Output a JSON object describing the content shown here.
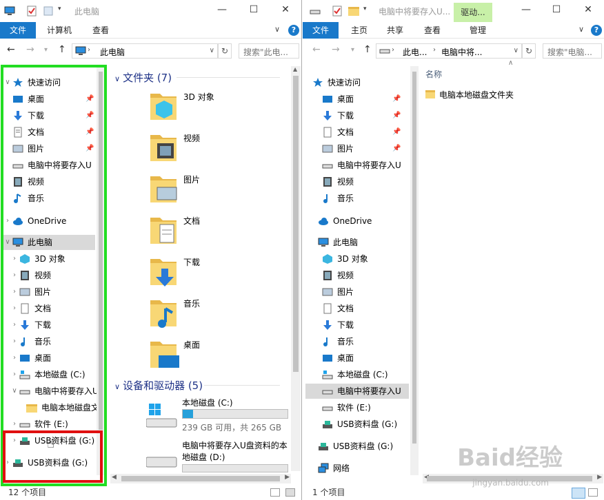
{
  "left": {
    "title": "此电脑",
    "ribbon": {
      "file": "文件",
      "tab1": "计算机",
      "tab2": "查看"
    },
    "address": {
      "path": "此电脑",
      "search_placeholder": "搜索\"此电..."
    },
    "nav": {
      "quick_access": "快速访问",
      "desktop": "桌面",
      "downloads": "下载",
      "documents": "文档",
      "pictures": "图片",
      "drive_d_short": "电脑中将要存入U",
      "videos": "视频",
      "music": "音乐",
      "onedrive": "OneDrive",
      "this_pc": "此电脑",
      "objects3d": "3D 对象",
      "videos2": "视频",
      "pictures2": "图片",
      "documents2": "文档",
      "downloads2": "下载",
      "music2": "音乐",
      "desktop2": "桌面",
      "drive_c": "本地磁盘 (C:)",
      "drive_d": "电脑中将要存入U",
      "subfolder": "电脑本地磁盘文",
      "drive_e": "软件 (E:)",
      "usb_g": "USB资料盘 (G:)",
      "usb_g2": "USB资料盘 (G:)"
    },
    "content": {
      "folders_header": "文件夹 (7)",
      "folders": [
        "3D 对象",
        "视频",
        "图片",
        "文档",
        "下载",
        "音乐",
        "桌面"
      ],
      "devices_header": "设备和驱动器 (5)",
      "drive_c_name": "本地磁盘 (C:)",
      "drive_c_space": "239 GB 可用，共 265 GB",
      "drive_c_used_fraction": 0.1,
      "drive_d_name_line1": "电脑中将要存入U盘资料的本",
      "drive_d_name_line2": "地磁盘 (D:)"
    },
    "status": "12 个项目"
  },
  "right": {
    "title": "电脑中将要存入U...",
    "context_tab": "驱动...",
    "ribbon": {
      "file": "文件",
      "tab1": "主页",
      "tab2": "共享",
      "tab3": "查看",
      "tab4": "管理"
    },
    "address": {
      "path1": "此电...",
      "path2": "电脑中将...",
      "search_placeholder": "搜索\"电脑..."
    },
    "nav": {
      "quick_access": "快速访问",
      "desktop": "桌面",
      "downloads": "下载",
      "documents": "文档",
      "pictures": "图片",
      "drive_d_short": "电脑中将要存入U",
      "videos": "视频",
      "music": "音乐",
      "onedrive": "OneDrive",
      "this_pc": "此电脑",
      "objects3d": "3D 对象",
      "videos2": "视频",
      "pictures2": "图片",
      "documents2": "文档",
      "downloads2": "下载",
      "music2": "音乐",
      "desktop2": "桌面",
      "drive_c": "本地磁盘 (C:)",
      "drive_d": "电脑中将要存入U",
      "drive_e": "软件 (E:)",
      "usb_g": "USB资料盘 (G:)",
      "usb_g2": "USB资料盘 (G:)",
      "network": "网络"
    },
    "content": {
      "column_name": "名称",
      "folder": "电脑本地磁盘文件夹"
    },
    "status": "1 个项目"
  },
  "watermark": {
    "main": "Baid经验",
    "sub": "jingyan.baidu.com"
  },
  "colors": {
    "accent": "#1979ca",
    "highlight_green": "#22dd22",
    "highlight_red": "#e01010",
    "folder": "#f8d775"
  }
}
